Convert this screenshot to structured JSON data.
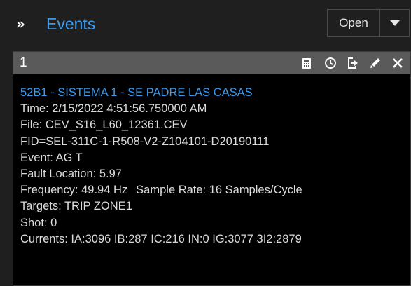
{
  "header": {
    "chevron": "»",
    "title": "Events",
    "open_label": "Open"
  },
  "panel": {
    "number": "1",
    "toolbar_icons": [
      "calculator-icon",
      "clock-icon",
      "export-icon",
      "pencil-icon",
      "close-icon"
    ],
    "event": {
      "title": "52B1 - SISTEMA 1 - SE PADRE LAS CASAS",
      "time": "Time:  2/15/2022 4:51:56.750000 AM",
      "file": "File: CEV_S16_L60_12361.CEV",
      "fid": "FID=SEL-311C-1-R508-V2-Z104101-D20190111",
      "event_type": "Event: AG T",
      "fault_location": "Fault Location: 5.97",
      "frequency": "Frequency: 49.94 Hz",
      "sample_rate": "Sample Rate: 16 Samples/Cycle",
      "targets": "Targets: TRIP ZONE1",
      "shot": "Shot: 0",
      "currents": "Currents: IA:3096 IB:287 IC:216 IN:0 IG:3077 3I2:2879"
    }
  },
  "colors": {
    "background": "#1f1f1f",
    "panel_bg": "#000000",
    "panel_header": "#5a5a5a",
    "accent": "#3b9cf0",
    "text": "#dcdcdc"
  }
}
